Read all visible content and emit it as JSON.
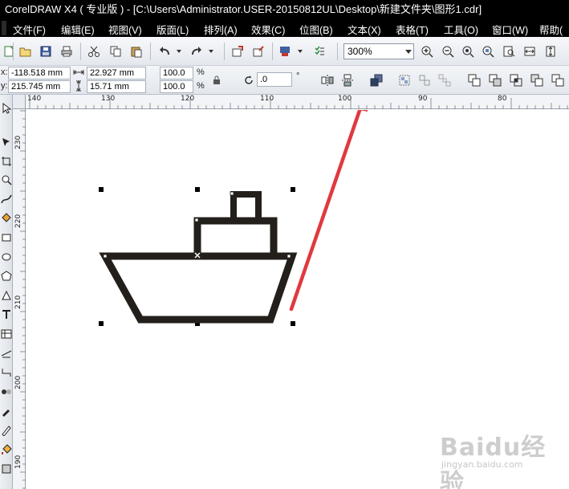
{
  "window": {
    "title": "CorelDRAW X4 ( 专业版 ) - [C:\\Users\\Administrator.USER-20150812UL\\Desktop\\新建文件夹\\图形1.cdr]"
  },
  "menu": {
    "items": [
      {
        "label": "文件(F)"
      },
      {
        "label": "编辑(E)"
      },
      {
        "label": "视图(V)"
      },
      {
        "label": "版面(L)"
      },
      {
        "label": "排列(A)"
      },
      {
        "label": "效果(C)"
      },
      {
        "label": "位图(B)"
      },
      {
        "label": "文本(X)"
      },
      {
        "label": "表格(T)"
      },
      {
        "label": "工具(O)"
      },
      {
        "label": "窗口(W)"
      },
      {
        "label": "帮助("
      }
    ]
  },
  "toolbar": {
    "zoom": "300%"
  },
  "property_bar": {
    "x_label": "x:",
    "x_value": "-118.518 mm",
    "y_label": "y:",
    "y_value": "215.745 mm",
    "width_value": "22.927 mm",
    "height_value": "15.71 mm",
    "scale_x": "100.0",
    "scale_y": "100.0",
    "percent": "%",
    "rotation_value": ".0",
    "degree": "°"
  },
  "rulers": {
    "horizontal_labels": [
      "140",
      "130",
      "120",
      "110",
      "100",
      "90",
      "80"
    ],
    "vertical_labels": [
      "230",
      "220",
      "210",
      "200",
      "190"
    ],
    "unit": "毫米"
  },
  "watermark": {
    "text": "Baidu经验",
    "sub": "jingyan.baidu.com"
  },
  "colors": {
    "annotation_arrow": "#e0393e",
    "shape_stroke": "#231f1a",
    "titlebar": "#000000"
  }
}
